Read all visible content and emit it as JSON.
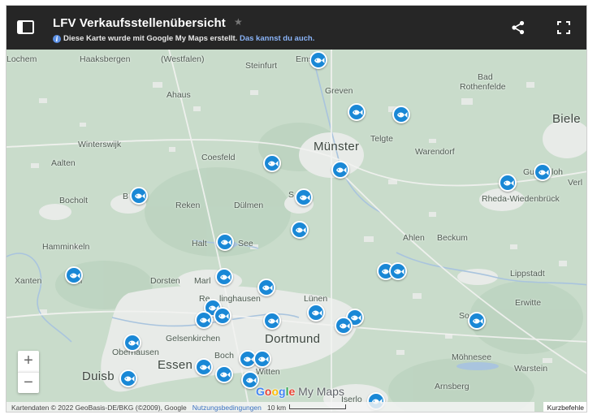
{
  "header": {
    "title": "LFV Verkaufsstellenübersicht",
    "info_text": "Diese Karte wurde mit Google My Maps erstellt.",
    "info_link": "Das kannst du auch."
  },
  "map": {
    "places": [
      {
        "label": "Lochem",
        "big": false
      },
      {
        "label": "Haaksbergen",
        "big": false
      },
      {
        "label": "(Westfalen)",
        "big": false
      },
      {
        "label": "Steinfurt",
        "big": false
      },
      {
        "label": "Ems",
        "big": false
      },
      {
        "label": "Bad",
        "big": false
      },
      {
        "label": "Rothenfelde",
        "big": false
      },
      {
        "label": "Ahaus",
        "big": false
      },
      {
        "label": "Greven",
        "big": false
      },
      {
        "label": "Biele",
        "big": true
      },
      {
        "label": "Winterswijk",
        "big": false
      },
      {
        "label": "Münster",
        "big": true
      },
      {
        "label": "Telgte",
        "big": false
      },
      {
        "label": "Warendorf",
        "big": false
      },
      {
        "label": "Aalten",
        "big": false
      },
      {
        "label": "Coesfeld",
        "big": false
      },
      {
        "label": "Gu",
        "big": false
      },
      {
        "label": "loh",
        "big": false
      },
      {
        "label": "Verl",
        "big": false
      },
      {
        "label": "Bocholt",
        "big": false
      },
      {
        "label": "B",
        "big": false
      },
      {
        "label": "S",
        "big": false
      },
      {
        "label": "Rheda-Wiedenbrück",
        "big": false
      },
      {
        "label": "Reken",
        "big": false
      },
      {
        "label": "Dülmen",
        "big": false
      },
      {
        "label": "Ahlen",
        "big": false
      },
      {
        "label": "Beckum",
        "big": false
      },
      {
        "label": "Hamminkeln",
        "big": false
      },
      {
        "label": "Halt",
        "big": false
      },
      {
        "label": "See",
        "big": false
      },
      {
        "label": "Xanten",
        "big": false
      },
      {
        "label": "el",
        "big": false
      },
      {
        "label": "Dorsten",
        "big": false
      },
      {
        "label": "Marl",
        "big": false
      },
      {
        "label": "Lippstadt",
        "big": false
      },
      {
        "label": "Re",
        "big": false
      },
      {
        "label": "linghausen",
        "big": false
      },
      {
        "label": "Lünen",
        "big": false
      },
      {
        "label": "Erwitte",
        "big": false
      },
      {
        "label": "Gelsenkirchen",
        "big": false
      },
      {
        "label": "So",
        "big": false
      },
      {
        "label": "Dortmund",
        "big": true
      },
      {
        "label": "Oberhausen",
        "big": false
      },
      {
        "label": "Boch",
        "big": false
      },
      {
        "label": "Möhnesee",
        "big": false
      },
      {
        "label": "Essen",
        "big": true
      },
      {
        "label": "Duisb",
        "big": true
      },
      {
        "label": "Witten",
        "big": false
      },
      {
        "label": "Warstein",
        "big": false
      },
      {
        "label": "Arnsberg",
        "big": false
      },
      {
        "label": "Iserlo",
        "big": false
      }
    ],
    "marker_icon": "fish-icon",
    "marker_color": "#1a88d6",
    "marker_count": 36,
    "zoom_in_label": "+",
    "zoom_out_label": "−"
  },
  "footer": {
    "logo_google": [
      "G",
      "o",
      "o",
      "g",
      "l",
      "e"
    ],
    "logo_mymaps": "My Maps",
    "attribution": "Kartendaten © 2022 GeoBasis-DE/BKG (©2009), Google",
    "terms_link": "Nutzungsbedingungen",
    "scale_label": "10 km",
    "shortcuts": "Kurzbefehle"
  },
  "colors": {
    "header_bg": "#262626",
    "map_bg": "#c9dccb",
    "urban": "#e9ece9",
    "water": "#a9c4de"
  }
}
